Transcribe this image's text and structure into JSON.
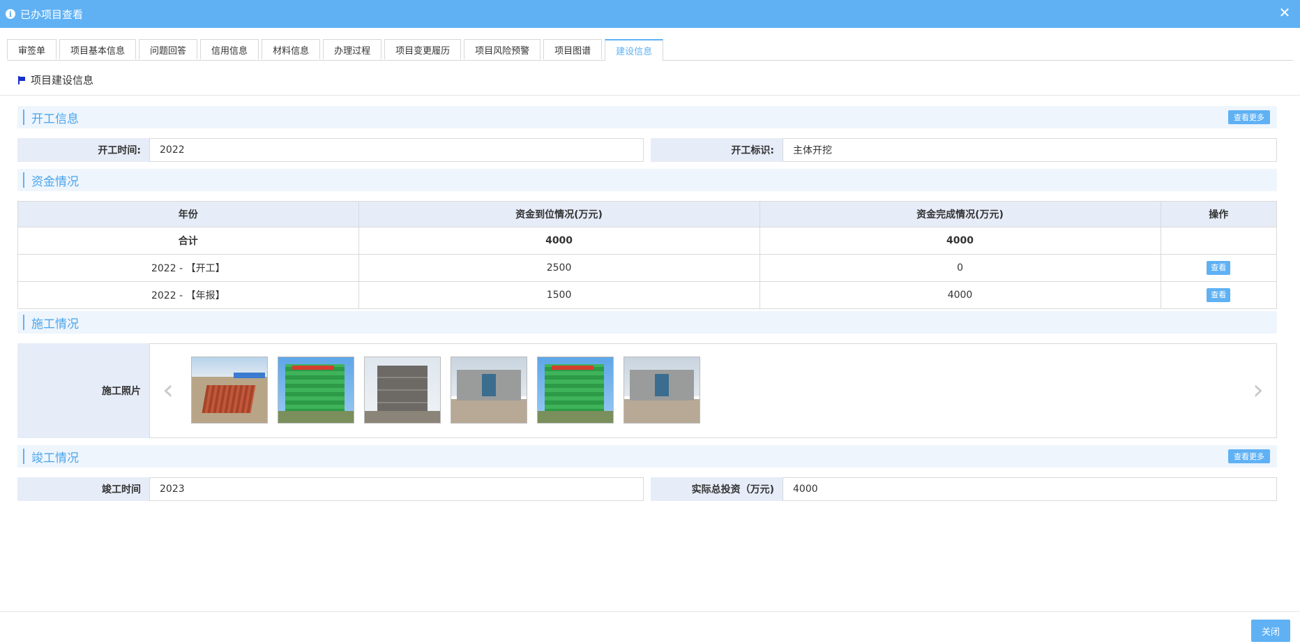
{
  "window": {
    "title": "已办项目查看",
    "close_glyph": "✕"
  },
  "tabs": [
    {
      "label": "审签单"
    },
    {
      "label": "项目基本信息"
    },
    {
      "label": "问题回答"
    },
    {
      "label": "信用信息"
    },
    {
      "label": "材料信息"
    },
    {
      "label": "办理过程"
    },
    {
      "label": "项目变更履历"
    },
    {
      "label": "项目风险预警"
    },
    {
      "label": "项目图谱"
    },
    {
      "label": "建设信息",
      "active": true
    }
  ],
  "section_title": "项目建设信息",
  "start": {
    "header": "开工信息",
    "more_label": "查看更多",
    "time_label": "开工时间:",
    "time_value": "2022",
    "mark_label": "开工标识:",
    "mark_value": "主体开挖"
  },
  "funds": {
    "header": "资金情况",
    "columns": [
      "年份",
      "资金到位情况(万元)",
      "资金完成情况(万元)",
      "操作"
    ],
    "rows": [
      {
        "year": "合计",
        "arrived": "4000",
        "completed": "4000",
        "action": ""
      },
      {
        "year": "2022 - 【开工】",
        "arrived": "2500",
        "completed": "0",
        "action": "查看"
      },
      {
        "year": "2022 - 【年报】",
        "arrived": "1500",
        "completed": "4000",
        "action": "查看"
      }
    ]
  },
  "construction": {
    "header": "施工情况",
    "photos_label": "施工照片",
    "prev_glyph": "‹",
    "next_glyph": "›"
  },
  "completion": {
    "header": "竣工情况",
    "more_label": "查看更多",
    "time_label": "竣工时间",
    "time_value": "2023",
    "invest_label": "实际总投资（万元)",
    "invest_value": "4000"
  },
  "footer": {
    "close_label": "关闭"
  },
  "colors": {
    "accent": "#5fb1f4",
    "header_bg": "#eef5fd",
    "label_bg": "#e6ecf8"
  }
}
